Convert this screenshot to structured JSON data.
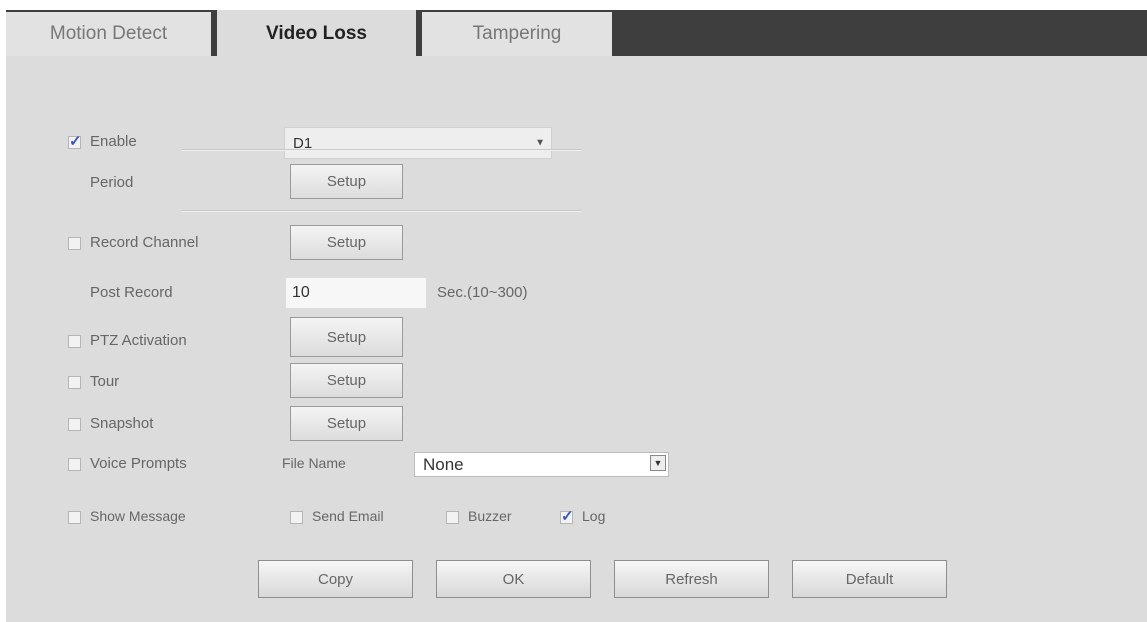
{
  "tabs": [
    {
      "label": "Motion Detect",
      "active": false
    },
    {
      "label": "Video Loss",
      "active": true
    },
    {
      "label": "Tampering",
      "active": false
    }
  ],
  "enable": {
    "label": "Enable",
    "checked": true,
    "channel_value": "D1"
  },
  "period": {
    "label": "Period",
    "button": "Setup"
  },
  "record_channel": {
    "label": "Record Channel",
    "checked": false,
    "button": "Setup"
  },
  "post_record": {
    "label": "Post Record",
    "value": "10",
    "unit": "Sec.(10~300)"
  },
  "ptz_activation": {
    "label": "PTZ Activation",
    "checked": false,
    "button": "Setup"
  },
  "tour": {
    "label": "Tour",
    "checked": false,
    "button": "Setup"
  },
  "snapshot": {
    "label": "Snapshot",
    "checked": false,
    "button": "Setup"
  },
  "voice_prompts": {
    "label": "Voice Prompts",
    "checked": false,
    "file_name_label": "File Name",
    "file_name_value": "None"
  },
  "show_message": {
    "label": "Show Message",
    "checked": false
  },
  "send_email": {
    "label": "Send Email",
    "checked": false
  },
  "buzzer": {
    "label": "Buzzer",
    "checked": false
  },
  "log": {
    "label": "Log",
    "checked": true
  },
  "footer": {
    "copy": "Copy",
    "ok": "OK",
    "refresh": "Refresh",
    "default": "Default"
  },
  "icons": {
    "dropdown": "chevron-down-icon",
    "check": "checkmark-icon"
  }
}
